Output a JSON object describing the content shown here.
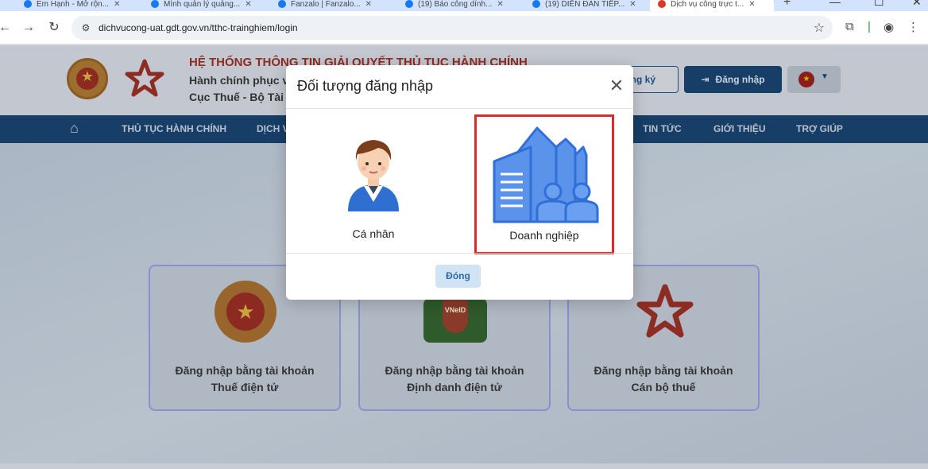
{
  "browser": {
    "tabs": [
      {
        "label": "Em Hạnh - Mở rộn..."
      },
      {
        "label": "Mình quản lý quảng..."
      },
      {
        "label": "Fanzalo | Fanzalo..."
      },
      {
        "label": "(19) Báo công dính..."
      },
      {
        "label": "(19) DIỄN ĐÀN TIẾP..."
      },
      {
        "label": "Dịch vụ công trực t..."
      }
    ],
    "url": "dichvucong-uat.gdt.gov.vn/tthc-trainghiem/login"
  },
  "header": {
    "title": "HỆ THỐNG THÔNG TIN GIẢI QUYẾT THỦ TỤC HÀNH CHÍNH",
    "subtitle1": "Hành chính phục v",
    "subtitle2": "Cục Thuế - Bộ Tài",
    "register_label": "ng ký",
    "login_label": "Đăng nhập"
  },
  "nav": {
    "items": [
      "THỦ TỤC HÀNH CHÍNH",
      "DỊCH V",
      "TIN TỨC",
      "GIỚI THIỆU",
      "TRỢ GIÚP"
    ]
  },
  "cards": [
    {
      "line1": "Đăng nhập bằng tài khoản",
      "line2": "Thuế điện tử"
    },
    {
      "line1": "Đăng nhập bằng tài khoản",
      "line2": "Định danh điện tử",
      "badge": "VNeID"
    },
    {
      "line1": "Đăng nhập bằng tài khoản",
      "line2": "Cán bộ thuế"
    }
  ],
  "modal": {
    "title": "Đối tượng đăng nhập",
    "options": [
      {
        "label": "Cá nhân",
        "icon": "person-icon"
      },
      {
        "label": "Doanh nghiệp",
        "icon": "building-icon"
      }
    ],
    "close_label": "Đóng"
  },
  "colors": {
    "navy": "#173e67",
    "highlight": "#e0272a",
    "building_blue": "#3b7de0"
  }
}
